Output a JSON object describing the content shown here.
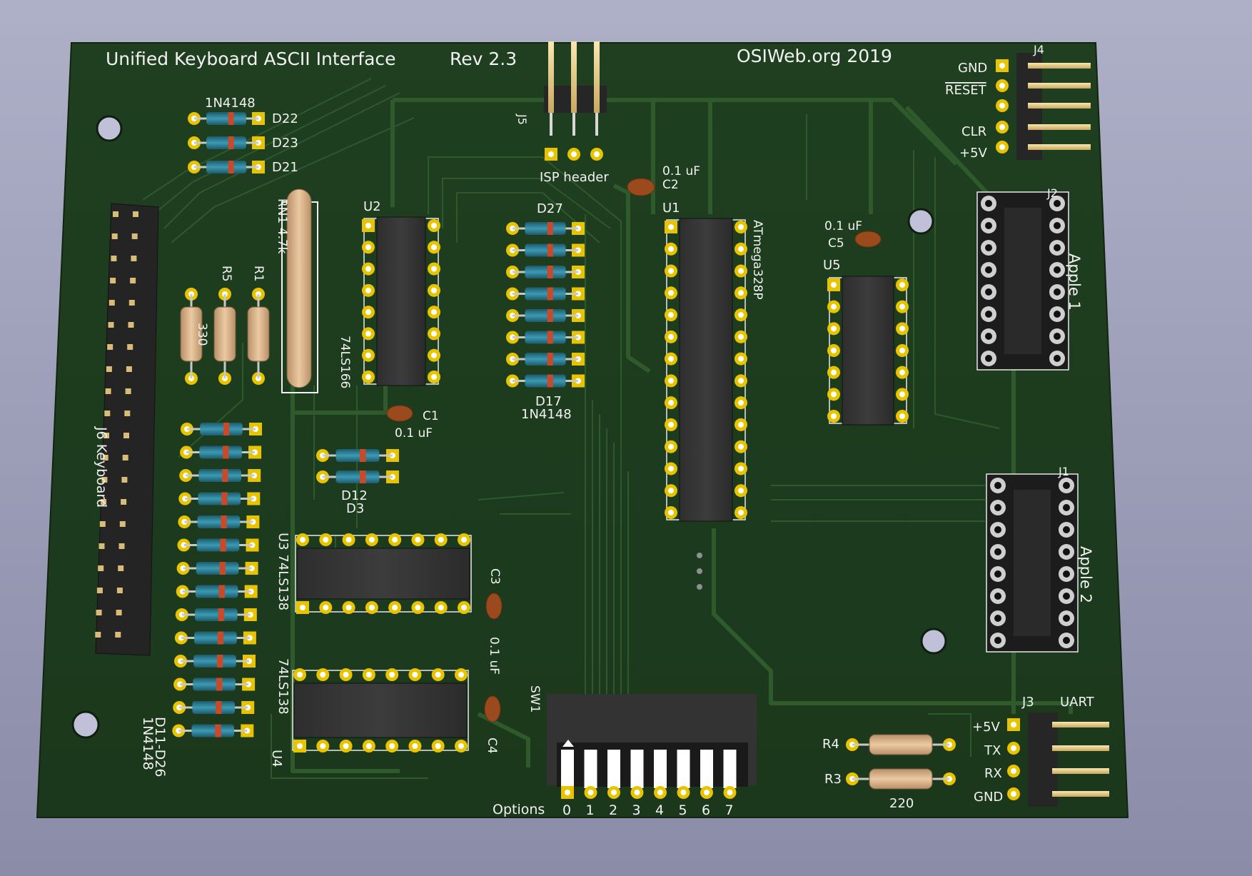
{
  "board": {
    "title": "Unified Keyboard ASCII Interface",
    "revision": "Rev 2.3",
    "credit": "OSIWeb.org 2019",
    "colors": {
      "pcb": "#1e3d1f",
      "trace": "#2f5a2c",
      "silkscreen": "#f2f2f2",
      "pad": "#e8c400",
      "ic": "#3a3a3a",
      "header": "#2a2a2a",
      "pin": "#e0c070",
      "resistor": "#d8b48a",
      "diode": "#2c7f96",
      "capacitor": "#a0501e",
      "background": "#a4a6c0"
    }
  },
  "labels": {
    "d_1n4148_top": "1N4148",
    "d22": "D22",
    "d23": "D23",
    "d21": "D21",
    "j5": "J5",
    "isp": "ISP header",
    "c2_val": "0.1 uF",
    "c2": "C2",
    "rn1": "RN1 4.7k",
    "r5": "R5",
    "r1": "R1",
    "r_val": "330",
    "u2": "U2",
    "u2_part": "74LS166",
    "d27": "D27",
    "d17": "D17",
    "d17_part": "1N4148",
    "u1": "U1",
    "u1_part": "ATmega328P",
    "c5_val": "0.1 uF",
    "c5": "C5",
    "u5": "U5",
    "j4": "J4",
    "gnd": "GND",
    "reset": "RESET",
    "clr": "CLR",
    "v5": "+5V",
    "j2": "J2",
    "apple1": "Apple 1",
    "c1": "C1",
    "c1_val": "0.1 uF",
    "j6": "J6 Keyboard",
    "d12": "D12",
    "d3": "D3",
    "u3": "U3 74LS138",
    "u4_part": "74LS138",
    "u4": "U4",
    "c3": "C3",
    "c34_val": "0.1 uF",
    "c4": "C4",
    "j1": "J1",
    "apple2": "Apple 2",
    "d11_26": "D11-D26",
    "d11_part": "1N4148",
    "sw1": "SW1",
    "options": "Options",
    "j3": "J3",
    "uart": "UART",
    "uart_v5": "+5V",
    "tx": "TX",
    "rx": "RX",
    "uart_gnd": "GND",
    "r4": "R4",
    "r3": "R3",
    "r34_val": "220"
  },
  "switch_numbers": [
    "0",
    "1",
    "2",
    "3",
    "4",
    "5",
    "6",
    "7"
  ]
}
